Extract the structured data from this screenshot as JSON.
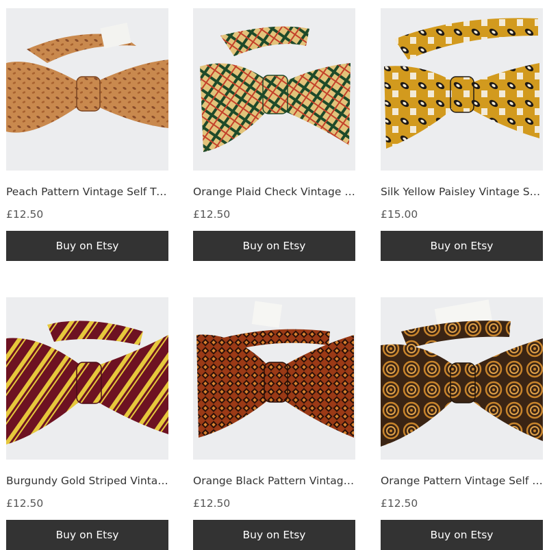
{
  "products": [
    {
      "title": "Peach Pattern Vintage Self Tie Bow Tie",
      "price": "£12.50",
      "button": "Buy on Etsy",
      "colors": {
        "bg": "#ecedef",
        "base": "#c9894e",
        "pattern": "#8a4d2a"
      },
      "image_label": "peach paisley bow tie"
    },
    {
      "title": "Orange Plaid Check Vintage Self Tie Bow Tie",
      "price": "£12.50",
      "button": "Buy on Etsy",
      "colors": {
        "bg": "#ecedef",
        "base": "#e2c37a",
        "pattern": "#1e4a2a"
      },
      "image_label": "orange plaid check bow tie"
    },
    {
      "title": "Silk Yellow Paisley Vintage Self Tie Bow Tie",
      "price": "£15.00",
      "button": "Buy on Etsy",
      "colors": {
        "bg": "#ecedef",
        "base": "#d29a1e",
        "pattern": "#1f1a17"
      },
      "image_label": "yellow paisley bow tie"
    },
    {
      "title": "Burgundy Gold Striped Vintage Self Tie Bow Tie",
      "price": "£12.50",
      "button": "Buy on Etsy",
      "colors": {
        "bg": "#ecedef",
        "base": "#6d1222",
        "pattern": "#e6c83c"
      },
      "image_label": "burgundy gold striped bow tie"
    },
    {
      "title": "Orange Black Pattern Vintage Self Tie Bow Tie",
      "price": "£12.50",
      "button": "Buy on Etsy",
      "colors": {
        "bg": "#ecedef",
        "base": "#9b3a16",
        "pattern": "#2a0f08"
      },
      "image_label": "orange black pattern bow tie"
    },
    {
      "title": "Orange Pattern Vintage Self Tie Bow Tie",
      "price": "£12.50",
      "button": "Buy on Etsy",
      "colors": {
        "bg": "#ecedef",
        "base": "#3a2414",
        "pattern": "#c9852c"
      },
      "image_label": "orange pattern bow tie"
    }
  ]
}
